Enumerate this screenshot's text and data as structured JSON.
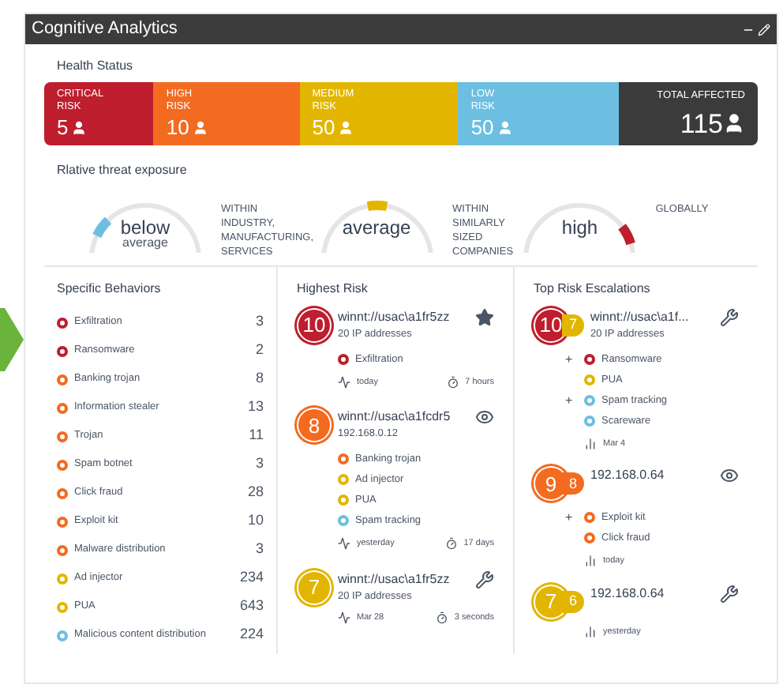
{
  "window": {
    "title": "Cognitive Analytics"
  },
  "health": {
    "title": "Health Status",
    "segments": [
      {
        "kind": "risk",
        "label": "CRITICAL",
        "sublabel": "RISK",
        "count": "5",
        "color": "#be1e2d"
      },
      {
        "kind": "risk",
        "label": "HIGH",
        "sublabel": "RISK",
        "count": "10",
        "color": "#f26b21"
      },
      {
        "kind": "risk",
        "label": "MEDIUM",
        "sublabel": "RISK",
        "count": "50",
        "color": "#e2b600"
      },
      {
        "kind": "risk",
        "label": "LOW",
        "sublabel": "RISK",
        "count": "50",
        "color": "#6cbfe1"
      },
      {
        "kind": "total",
        "label": "TOTAL AFFECTED",
        "count": "115",
        "color": "#3b3b3b"
      }
    ]
  },
  "exposure": {
    "title": "Rlative threat exposure",
    "gauges": [
      {
        "kind": "below",
        "value": "below",
        "subvalue": "average",
        "caption": "WITHIN INDUSTRY, MANUFACTURING, SERVICES",
        "color": "#6cbfe1"
      },
      {
        "kind": "average",
        "value": "average",
        "caption": "WITHIN SIMILARLY SIZED COMPANIES",
        "color": "#e2b600"
      },
      {
        "kind": "high",
        "value": "high",
        "caption": "GLOBALLY",
        "color": "#be1e2d"
      }
    ]
  },
  "behaviors": {
    "title": "Specific Behaviors",
    "items": [
      {
        "name": "Exfiltration",
        "count": "3",
        "color": "#be1e2d"
      },
      {
        "name": "Ransomware",
        "count": "2",
        "color": "#be1e2d"
      },
      {
        "name": "Banking trojan",
        "count": "8",
        "color": "#f26b21"
      },
      {
        "name": "Information stealer",
        "count": "13",
        "color": "#f26b21"
      },
      {
        "name": "Trojan",
        "count": "11",
        "color": "#f26b21"
      },
      {
        "name": "Spam botnet",
        "count": "3",
        "color": "#f26b21"
      },
      {
        "name": "Click fraud",
        "count": "28",
        "color": "#f26b21"
      },
      {
        "name": "Exploit kit",
        "count": "10",
        "color": "#f26b21"
      },
      {
        "name": "Malware distribution",
        "count": "3",
        "color": "#f26b21"
      },
      {
        "name": "Ad injector",
        "count": "234",
        "color": "#e2b600"
      },
      {
        "name": "PUA",
        "count": "643",
        "color": "#e2b600"
      },
      {
        "name": "Malicious content distribution",
        "count": "224",
        "color": "#6cbfe1"
      }
    ]
  },
  "highest_risk": {
    "title": "Highest Risk",
    "items": [
      {
        "score": "10",
        "color": "#be1e2d",
        "name": "winnt://usac\\a1fr5zz",
        "detail": "20 IP addresses",
        "kind": "star",
        "behaviors": [
          {
            "name": "Exfiltration",
            "color": "#be1e2d"
          }
        ],
        "date": "today",
        "duration": "7 hours"
      },
      {
        "score": "8",
        "color": "#f26b21",
        "name": "winnt://usac\\a1fcdr5",
        "detail": "192.168.0.12",
        "kind": "eye",
        "behaviors": [
          {
            "name": "Banking trojan",
            "color": "#f26b21"
          },
          {
            "name": "Ad injector",
            "color": "#e2b600"
          },
          {
            "name": "PUA",
            "color": "#e2b600"
          },
          {
            "name": "Spam tracking",
            "color": "#6cbfe1"
          }
        ],
        "date": "yesterday",
        "duration": "17 days"
      },
      {
        "score": "7",
        "color": "#e2b600",
        "name": "winnt://usac\\a1fr5zz",
        "detail": "20 IP addresses",
        "kind": "wrench",
        "date": "Mar 28",
        "duration": "3 seconds"
      }
    ]
  },
  "escalations": {
    "title": "Top Risk Escalations",
    "items": [
      {
        "score": "10",
        "color": "#be1e2d",
        "previous": {
          "score": "7",
          "color": "#e2b600"
        },
        "name": "winnt://usac\\a1f...",
        "detail": "20 IP addresses",
        "kind": "wrench",
        "behaviors": [
          {
            "marker": "+",
            "name": "Ransomware",
            "color": "#be1e2d"
          },
          {
            "name": "PUA",
            "color": "#e2b600"
          },
          {
            "marker": "+",
            "name": "Spam tracking",
            "color": "#6cbfe1"
          },
          {
            "name": "Scareware",
            "color": "#6cbfe1"
          }
        ],
        "date": "Mar 4"
      },
      {
        "score": "9",
        "color": "#f26b21",
        "previous": {
          "score": "8",
          "color": "#f26b21"
        },
        "name": "192.168.0.64",
        "kind": "eye",
        "behaviors": [
          {
            "marker": "+",
            "name": "Exploit kit",
            "color": "#f26b21"
          },
          {
            "name": "Click fraud",
            "color": "#f26b21"
          }
        ],
        "date": "today"
      },
      {
        "score": "7",
        "color": "#e2b600",
        "previous": {
          "score": "6",
          "color": "#e2b600"
        },
        "name": "192.168.0.64",
        "kind": "wrench",
        "date": "yesterday"
      }
    ]
  }
}
